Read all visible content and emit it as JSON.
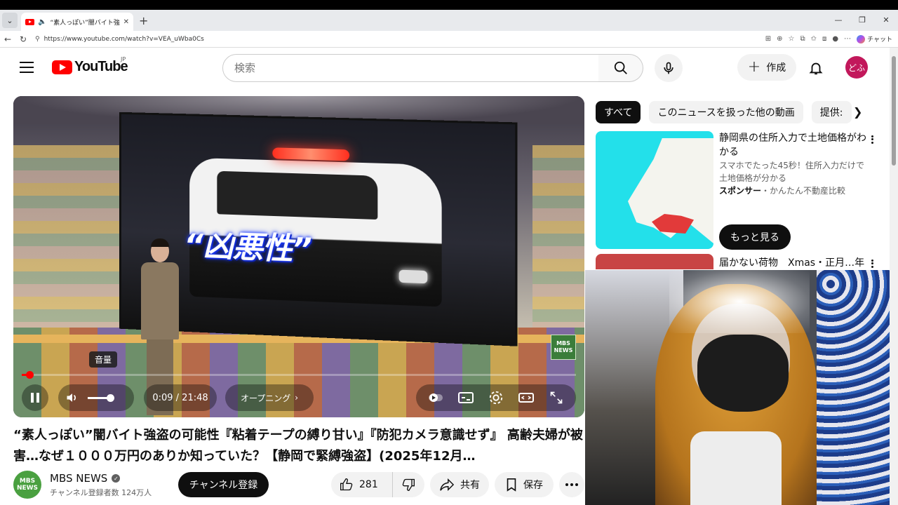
{
  "browser": {
    "tab_title": "“素人っぽい”闇バイト強盗の可能",
    "url": "https://www.youtube.com/watch?v=VEA_uWba0Cs",
    "chat_label": "チャット"
  },
  "masthead": {
    "logo_text": "YouTube",
    "region": "JP",
    "search_placeholder": "検索",
    "create_label": "作成",
    "avatar_text": "どふ"
  },
  "player": {
    "caption": "“凶悪性”",
    "bug_line1": "MBS",
    "bug_line2": "NEWS",
    "volume_tooltip": "音量",
    "time": "0:09 / 21:48",
    "chapter": "オープニング",
    "progress": 0.007
  },
  "video": {
    "title": "“素人っぽい”闇バイト強盗の可能性『粘着テープの縛り甘い』『防犯カメラ意識せず』 高齢夫婦が被害…なぜ１０００万円のありか知っていた？【静岡で緊縛強盗】(2025年12月…",
    "channel_avatar_line1": "MBS",
    "channel_avatar_line2": "NEWS",
    "channel_name": "MBS NEWS",
    "subscribers": "チャンネル登録者数 124万人",
    "subscribe_label": "チャンネル登録",
    "likes": "281",
    "share_label": "共有",
    "save_label": "保存"
  },
  "sidebar": {
    "chips": [
      "すべて",
      "このニュースを扱った他の動画",
      "提供:"
    ],
    "ad": {
      "title": "静岡県の住所入力で土地価格がわかる",
      "description": "スマホでたった45秒！住所入力だけで土地価格が分かる",
      "sponsor_prefix": "スポンサー",
      "sponsor_name": "・かんたん不動産比較",
      "cta": "もっと見る"
    },
    "next_title": "届かない荷物　Xmas・正月…年"
  },
  "colors": {
    "brand_red": "#ff0000",
    "text_primary": "#0f0f0f",
    "text_secondary": "#606060",
    "avatar": "#c2185b"
  }
}
